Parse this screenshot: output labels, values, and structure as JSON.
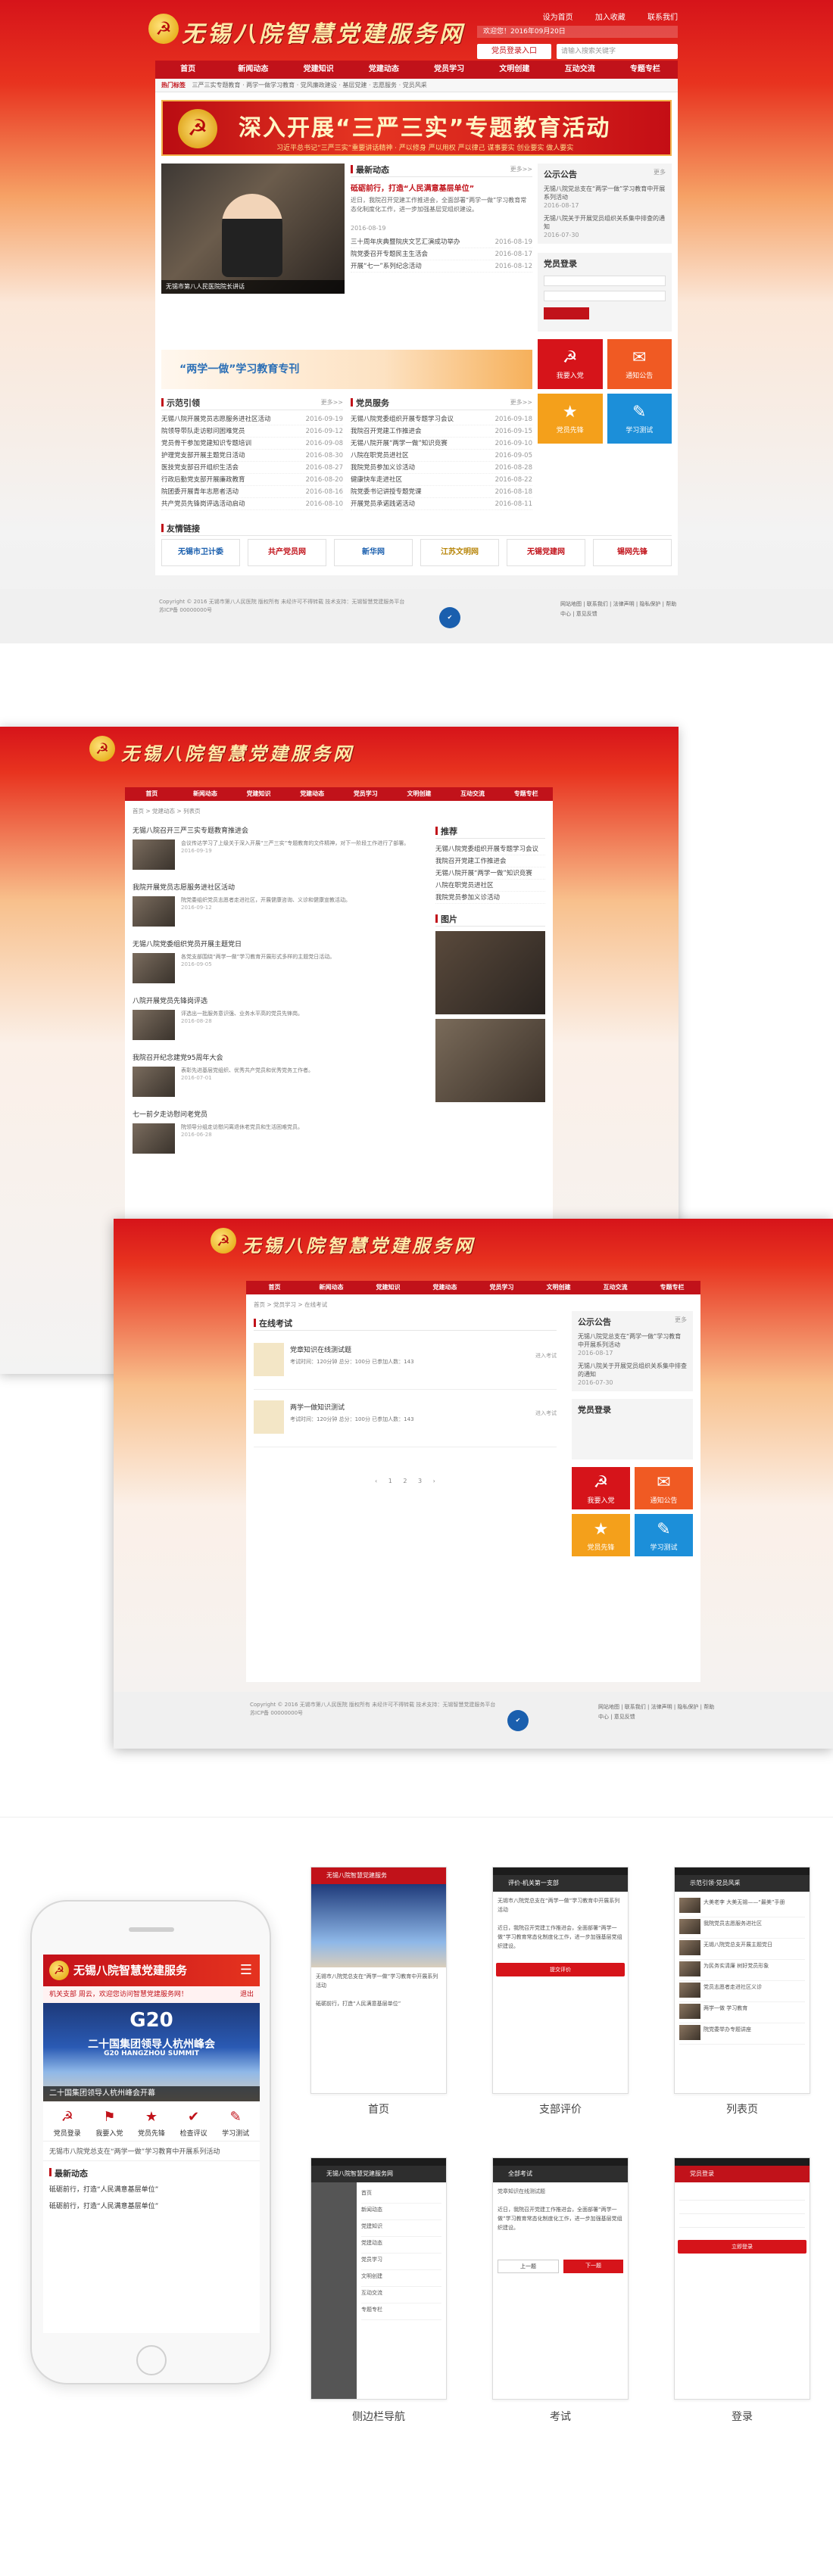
{
  "site": {
    "name": "无锡八院智慧党建服务网",
    "emblem": "☭"
  },
  "home": {
    "top_links": [
      "设为首页",
      "加入收藏",
      "联系我们"
    ],
    "date_text": "欢迎您！2016年09月20日",
    "login_label": "党员登录入口",
    "search_placeholder": "请输入搜索关键字",
    "nav": [
      "首页",
      "新闻动态",
      "党建知识",
      "党建动态",
      "党员学习",
      "文明创建",
      "互动交流",
      "专题专栏"
    ],
    "subnav_hot": "热门标签",
    "subnav_text": "三严三实专题教育 · 两学一做学习教育 · 党风廉政建设 · 基层党建 · 志愿服务 · 党员风采",
    "banner_title": "深入开展“三严三实”专题教育活动",
    "banner_sub": "习近平总书记“三严三实”重要讲话精神 · 严以修身 严以用权 严以律己 谋事要实 创业要实 做人要实",
    "photo_caption": "无锡市第八人民医院院长讲话",
    "news_head": "最新动态",
    "news_more": "更多>>",
    "news_lead_title": "砥砺前行，打造“人民满意基层单位”",
    "news_lead_text": "近日，我院召开党建工作推进会，全面部署“两学一做”学习教育常态化制度化工作，进一步加强基层党组织建设。",
    "news_lead_date": "2016-08-19",
    "news_list": [
      {
        "t": "三十周年庆典暨院庆文艺汇演成功举办",
        "d": "2016-08-19"
      },
      {
        "t": "院党委召开专题民主生活会",
        "d": "2016-08-17"
      },
      {
        "t": "开展“七一”系列纪念活动",
        "d": "2016-08-12"
      }
    ],
    "promo": "“两学一做”学习教育专刊",
    "notice_head": "公示公告",
    "notice_more": "更多",
    "notices": [
      {
        "t": "无锡八院党总支在“两学一做”学习教育中开展系列活动",
        "d": "2016-08-17"
      },
      {
        "t": "无锡八院关于开展党员组织关系集中排查的通知",
        "d": "2016-07-30"
      }
    ],
    "login_box_head": "党员登录",
    "tiles": [
      {
        "label": "我要入党",
        "icon": "☭",
        "color": "#d6141a"
      },
      {
        "label": "通知公告",
        "icon": "✉",
        "color": "#f05a23"
      },
      {
        "label": "党员先锋",
        "icon": "★",
        "color": "#f4a01b"
      },
      {
        "label": "学习测试",
        "icon": "✎",
        "color": "#1c8fd9"
      }
    ],
    "left_head": "示范引领",
    "left_list": [
      {
        "t": "无锡八院开展党员志愿服务进社区活动",
        "d": "2016-09-19"
      },
      {
        "t": "院领导带队走访慰问困难党员",
        "d": "2016-09-12"
      },
      {
        "t": "党员骨干参加党建知识专题培训",
        "d": "2016-09-08"
      },
      {
        "t": "护理党支部开展主题党日活动",
        "d": "2016-08-30"
      },
      {
        "t": "医技党支部召开组织生活会",
        "d": "2016-08-27"
      },
      {
        "t": "行政后勤党支部开展廉政教育",
        "d": "2016-08-20"
      },
      {
        "t": "院团委开展青年志愿者活动",
        "d": "2016-08-16"
      },
      {
        "t": "共产党员先锋岗评选活动启动",
        "d": "2016-08-10"
      }
    ],
    "right_head": "党员服务",
    "right_list": [
      {
        "t": "无锡八院党委组织开展专题学习会议",
        "d": "2016-09-18"
      },
      {
        "t": "我院召开党建工作推进会",
        "d": "2016-09-15"
      },
      {
        "t": "无锡八院开展“两学一做”知识竞赛",
        "d": "2016-09-10"
      },
      {
        "t": "八院在职党员进社区",
        "d": "2016-09-05"
      },
      {
        "t": "我院党员参加义诊活动",
        "d": "2016-08-28"
      },
      {
        "t": "健康快车走进社区",
        "d": "2016-08-22"
      },
      {
        "t": "院党委书记讲授专题党课",
        "d": "2016-08-18"
      },
      {
        "t": "开展党员承诺践诺活动",
        "d": "2016-08-11"
      }
    ],
    "links_head": "友情链接",
    "links": [
      "无锡市卫计委",
      "共产党员网",
      "新华网",
      "江苏文明网",
      "无锡党建网",
      "锡网先锋"
    ],
    "footer_copy": "Copyright © 2016 无锡市第八人民医院 版权所有 未经许可不得转载 技术支持：无锡智慧党建服务平台 苏ICP备 00000000号",
    "footer_links": "网站地图 | 联系我们 | 法律声明 | 隐私保护 | 帮助中心 | 意见反馈"
  },
  "list_page": {
    "crumb": "首页 > 党建动态 > 列表页",
    "articles": [
      {
        "t": "无锡八院召开三严三实专题教育推进会",
        "x": "会议传达学习了上级关于深入开展“三严三实”专题教育的文件精神，对下一阶段工作进行了部署。",
        "d": "2016-09-19"
      },
      {
        "t": "我院开展党员志愿服务进社区活动",
        "x": "院党委组织党员志愿者走进社区，开展健康咨询、义诊和健康宣教活动。",
        "d": "2016-09-12"
      },
      {
        "t": "无锡八院党委组织党员开展主题党日",
        "x": "各党支部围绕“两学一做”学习教育开展形式多样的主题党日活动。",
        "d": "2016-09-05"
      },
      {
        "t": "八院开展党员先锋岗评选",
        "x": "评选出一批服务意识强、业务水平高的党员先锋岗。",
        "d": "2016-08-28"
      },
      {
        "t": "我院召开纪念建党95周年大会",
        "x": "表彰先进基层党组织、优秀共产党员和优秀党务工作者。",
        "d": "2016-07-01"
      },
      {
        "t": "七一前夕走访慰问老党员",
        "x": "院领导分组走访慰问离退休老党员和生活困难党员。",
        "d": "2016-06-28"
      }
    ],
    "side_head": "推荐",
    "photo_head": "图片"
  },
  "exam_page": {
    "crumb": "首页 > 党员学习 > 在线考试",
    "head": "在线考试",
    "exams": [
      {
        "t": "党章知识在线测试题",
        "m": "考试时间：120分钟   总分：100分   已参加人数：143",
        "go": "进入考试"
      },
      {
        "t": "两学一做知识测试",
        "m": "考试时间：120分钟   总分：100分   已参加人数：143",
        "go": "进入考试"
      }
    ],
    "pager": "‹ 1 2 3 ›"
  },
  "mobile": {
    "header": "无锡八院智慧党建服务",
    "marquee": "机关支部 周云，欢迎您访问智慧党建服务网！",
    "marquee_right": "退出",
    "hero_logo": "G20",
    "hero_title": "二十国集团领导人杭州峰会",
    "hero_sub": "G20 HANGZHOU SUMMIT",
    "hero_caption": "二十国集团领导人杭州峰会开幕",
    "icons": [
      {
        "label": "党员登录",
        "icon": "☭"
      },
      {
        "label": "我要入党",
        "icon": "⚑"
      },
      {
        "label": "党员先锋",
        "icon": "★"
      },
      {
        "label": "检查评议",
        "icon": "✔"
      },
      {
        "label": "学习测试",
        "icon": "✎"
      }
    ],
    "notice": "无锡市八院党总支在“两学一做”学习教育中开展系列活动",
    "news_head": "最新动态",
    "news": [
      "砥砺前行，打造“人民满意基层单位”",
      "砥砺前行，打造“人民满意基层单位”"
    ],
    "screens": [
      {
        "name": "首页",
        "bar": "无锡八院智慧党建服务"
      },
      {
        "name": "支部评价",
        "bar": "评价-机关第一支部"
      },
      {
        "name": "列表页",
        "bar": "示范引领·党员风采"
      },
      {
        "name": "侧边栏导航",
        "bar": "无锡八院智慧党建服务网"
      },
      {
        "name": "考试",
        "bar": "全部考试"
      },
      {
        "name": "登录",
        "bar": "党员登录"
      }
    ],
    "eval_button": "提交评价",
    "login_button": "立即登录",
    "exam_prev": "上一题",
    "exam_next": "下一题",
    "side_items": [
      "首页",
      "新闻动态",
      "党建知识",
      "党建动态",
      "党员学习",
      "文明创建",
      "互动交流",
      "专题专栏"
    ],
    "list_items": [
      "大美老李 大美无锡——“最美”手册",
      "我院党员志愿服务进社区",
      "无锡八院党总支开展主题党日",
      "为民务实清廉 树好党员形象",
      "党员志愿者走进社区义诊",
      "两学一做 学习教育",
      "院党委举办专题讲座"
    ]
  }
}
